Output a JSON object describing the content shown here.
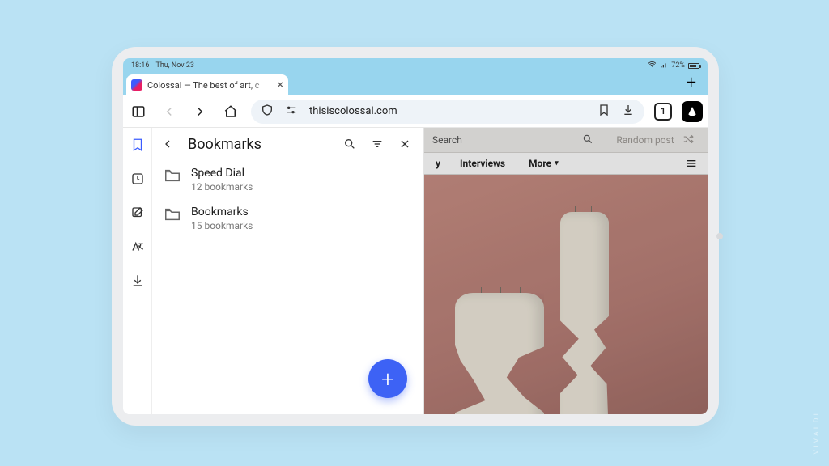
{
  "status": {
    "time": "18:16",
    "date": "Thu, Nov 23",
    "battery_pct": "72%"
  },
  "tab": {
    "title": "Colossal — The best of art, c"
  },
  "toolbar": {
    "url": "thisiscolossal.com",
    "tab_count": "1"
  },
  "panel": {
    "title": "Bookmarks",
    "folders": [
      {
        "name": "Speed Dial",
        "count": "12 bookmarks"
      },
      {
        "name": "Bookmarks",
        "count": "15 bookmarks"
      }
    ]
  },
  "site": {
    "search_placeholder": "Search",
    "random_label": "Random post",
    "nav1_partial": "y",
    "nav2": "Interviews",
    "nav3": "More"
  },
  "brand": "VIVALDI"
}
